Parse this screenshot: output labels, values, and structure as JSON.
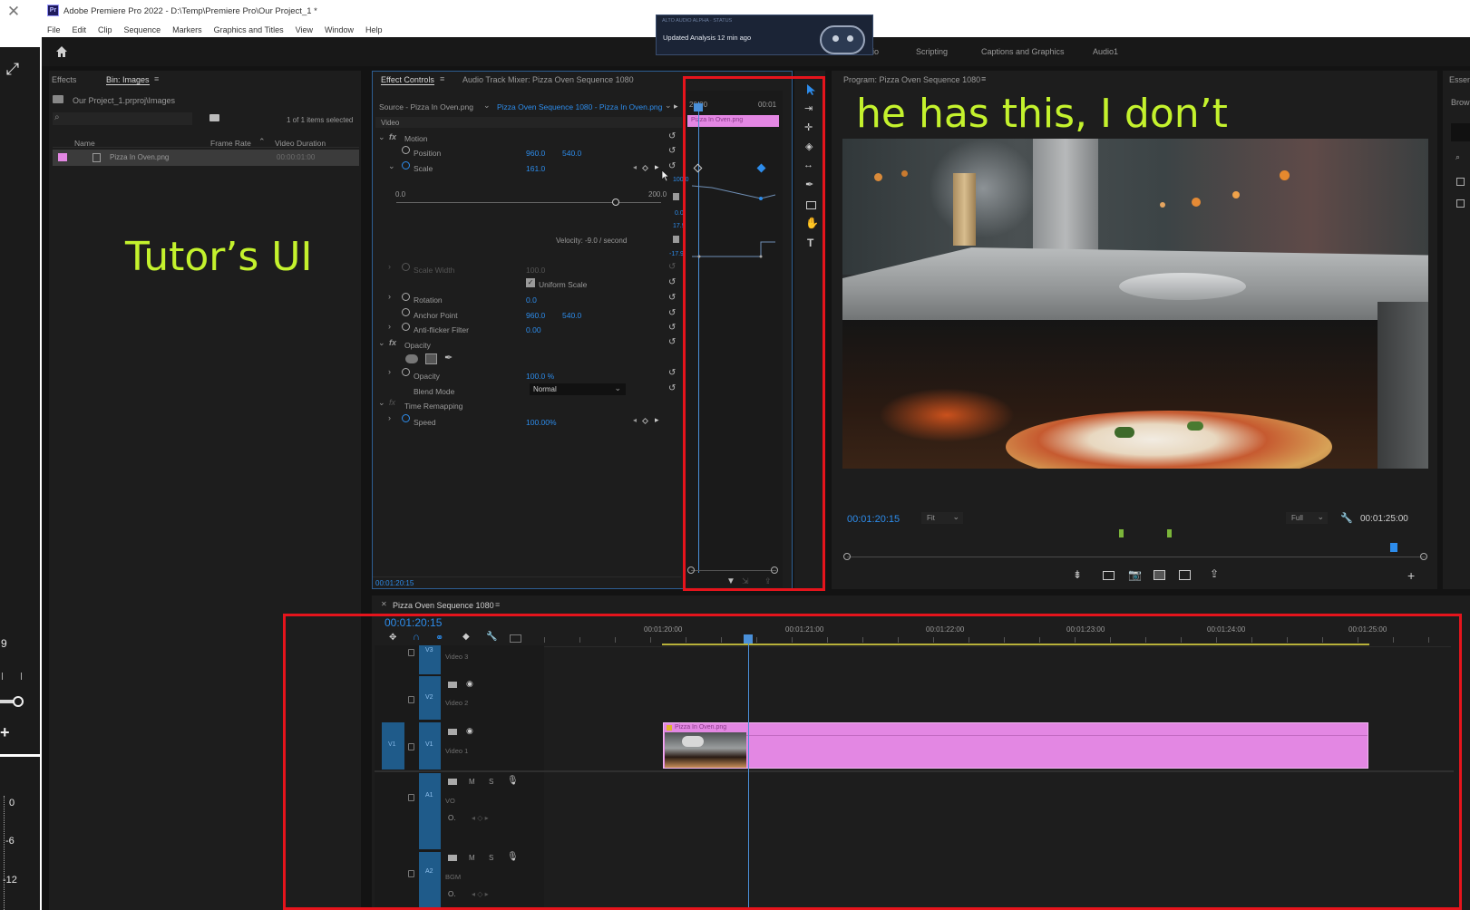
{
  "window": {
    "title": "Adobe Premiere Pro 2022 - D:\\Temp\\Premiere Pro\\Our Project_1 *",
    "app_badge": "Pr"
  },
  "menu": [
    "File",
    "Edit",
    "Clip",
    "Sequence",
    "Markers",
    "Graphics and Titles",
    "View",
    "Window",
    "Help"
  ],
  "toast": {
    "header": "ALTO AUDIO ALPHA · STATUS",
    "text": "Updated Analysis 12 min ago"
  },
  "workspaces": [
    "Scripting",
    "Captions and Graphics",
    "Audio1"
  ],
  "left_strip": {
    "val_9": "9",
    "scale": [
      "0",
      "-6",
      "-12"
    ]
  },
  "project": {
    "tabs": [
      "Effects",
      "Bin: Images"
    ],
    "path": "Our Project_1.prproj\\Images",
    "items_selected": "1 of 1 items selected",
    "columns": [
      "Name",
      "Frame Rate",
      "Video Duration"
    ],
    "rows": [
      {
        "name": "Pizza In Oven.png",
        "duration": "00:00:01:00"
      }
    ]
  },
  "effect_controls": {
    "tabs": [
      "Effect Controls",
      "Audio Track Mixer: Pizza Oven Sequence 1080"
    ],
    "source": "Source - Pizza In Oven.png",
    "sequence": "Pizza Oven Sequence 1080 - Pizza In Oven.png",
    "ruler": [
      "20:00",
      "00:01"
    ],
    "clip_label": "Pizza In Oven.png",
    "section_video": "Video",
    "motion": "Motion",
    "position_label": "Position",
    "position_x": "960.0",
    "position_y": "540.0",
    "scale_label": "Scale",
    "scale_value": "161.0",
    "slider_min": "0.0",
    "slider_max": "200.0",
    "graph_vals": [
      "100.0",
      "0.0",
      "17.9",
      "-17.9"
    ],
    "velocity": "Velocity: -9.0 / second",
    "scale_width_label": "Scale Width",
    "scale_width_value": "100.0",
    "uniform_scale": "Uniform Scale",
    "rotation_label": "Rotation",
    "rotation_value": "0.0",
    "anchor_label": "Anchor Point",
    "anchor_x": "960.0",
    "anchor_y": "540.0",
    "antiflicker_label": "Anti-flicker Filter",
    "antiflicker_value": "0.00",
    "opacity_section": "Opacity",
    "opacity_label": "Opacity",
    "opacity_value": "100.0 %",
    "blend_label": "Blend Mode",
    "blend_value": "Normal",
    "time_remap": "Time Remapping",
    "speed_label": "Speed",
    "speed_value": "100.00%",
    "timecode": "00:01:20:15"
  },
  "program": {
    "title": "Program: Pizza Oven Sequence 1080",
    "timecode": "00:01:20:15",
    "fit": "Fit",
    "full": "Full",
    "duration": "00:01:25:00"
  },
  "timeline": {
    "title": "Pizza Oven Sequence 1080",
    "timecode": "00:01:20:15",
    "ruler": [
      "00:01:20:00",
      "00:01:21:00",
      "00:01:22:00",
      "00:01:23:00",
      "00:01:24:00",
      "00:01:25:00"
    ],
    "tracks": [
      {
        "id": "V3",
        "name": "Video 3"
      },
      {
        "id": "V2",
        "name": "Video 2"
      },
      {
        "id": "V1",
        "name": "Video 1",
        "src": "V1"
      },
      {
        "id": "A1",
        "name": "VO"
      },
      {
        "id": "A2",
        "name": "BGM"
      }
    ],
    "clip_label": "Pizza In Oven.png",
    "m": "M",
    "s": "S"
  },
  "annotations": {
    "left": "Tutor’s UI",
    "right": "he has this, I don’t"
  },
  "colors": {
    "panel": "#1d1d1d",
    "accent": "#2d8ceb",
    "clip": "#e387e3",
    "highlight": "#e5141c",
    "annotation": "#c4f22d"
  }
}
